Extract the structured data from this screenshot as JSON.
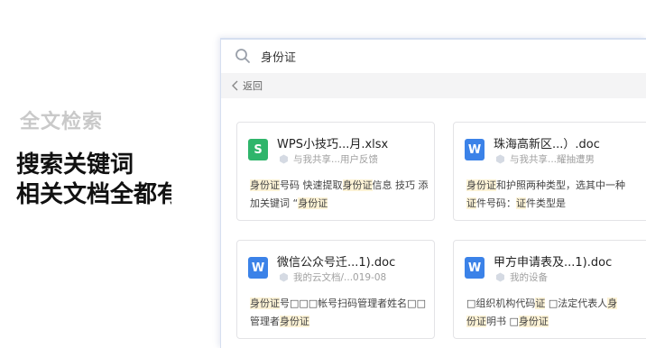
{
  "promo": {
    "subtitle": "全文检索",
    "line1": "搜索关键词",
    "line2": "相关文档全都有"
  },
  "search": {
    "query": "身份证"
  },
  "nav": {
    "back_label": "返回"
  },
  "results": [
    {
      "type": "xls",
      "icon_letter": "S",
      "name": "WPS小技巧...月.xlsx",
      "location": "与我共享...用户反馈",
      "snippet": [
        {
          "t": "身份证",
          "h": true
        },
        {
          "t": "号码 快速提取"
        },
        {
          "t": "身份证",
          "h": true
        },
        {
          "t": "信息 技巧 添加关键词 “"
        },
        {
          "t": "身份证",
          "h": true
        }
      ]
    },
    {
      "type": "doc",
      "icon_letter": "W",
      "name": "珠海高新区...）.doc",
      "location": "与我共享...耀抽遭男",
      "snippet": [
        {
          "t": "身份证",
          "h": true
        },
        {
          "t": "和护照两种类型，选其中一种 "
        },
        {
          "t": "证",
          "h": true
        },
        {
          "t": "件号码："
        },
        {
          "t": "证",
          "h": true
        },
        {
          "t": "件类型是"
        }
      ]
    },
    {
      "type": "doc",
      "icon_letter": "W",
      "name": "微信公众号迁...1).doc",
      "location": "我的云文档/...019-08",
      "snippet": [
        {
          "t": "身份证",
          "h": true
        },
        {
          "t": "号□□□帐号扫码管理者姓名□□管理者"
        },
        {
          "t": "身份证",
          "h": true
        }
      ]
    },
    {
      "type": "doc",
      "icon_letter": "W",
      "name": "甲方申请表及...1).doc",
      "location": "我的设备",
      "snippet": [
        {
          "t": " □组织机构代码"
        },
        {
          "t": "证",
          "h": true
        },
        {
          "t": " □法定代表人"
        },
        {
          "t": "身份证",
          "h": true
        },
        {
          "t": "明书 □"
        },
        {
          "t": "身份证",
          "h": true
        }
      ]
    }
  ]
}
